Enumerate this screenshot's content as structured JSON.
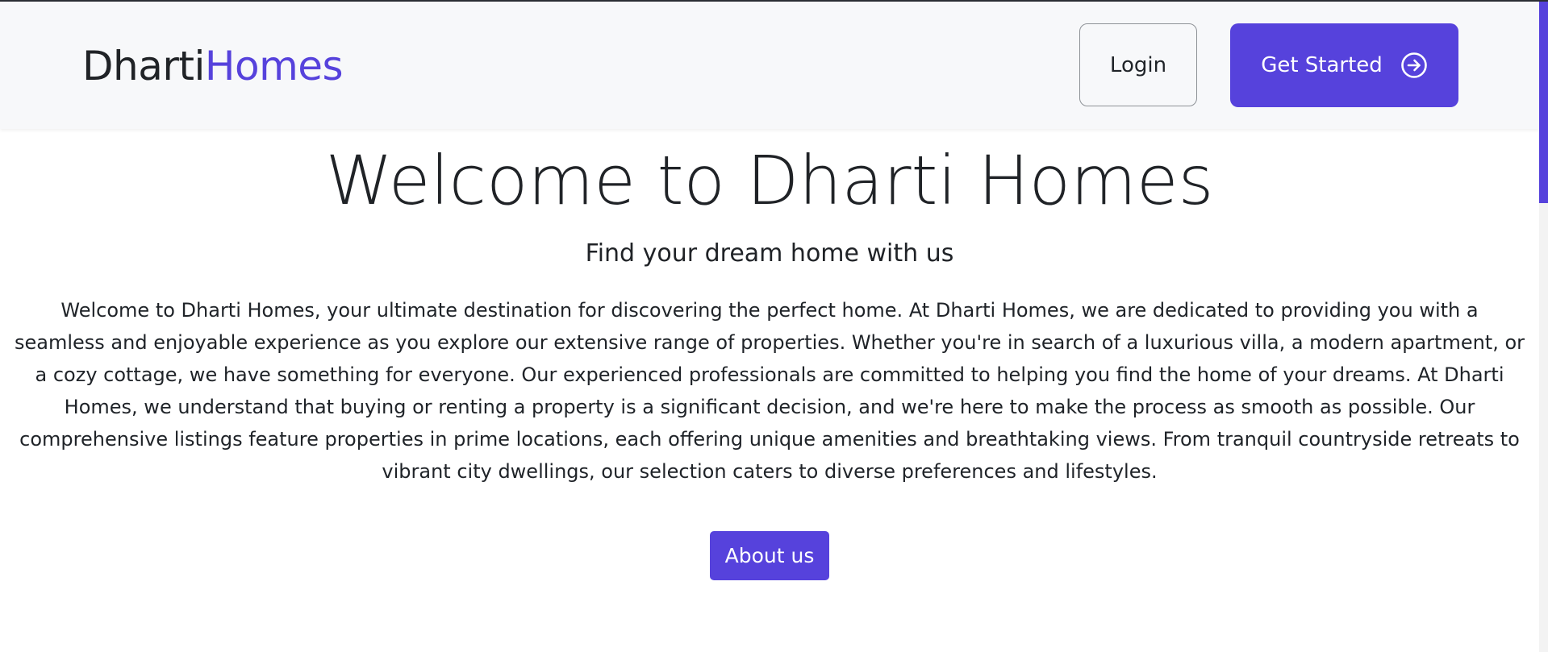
{
  "navbar": {
    "brand_part1": "Dharti",
    "brand_part2": "Homes",
    "login_label": "Login",
    "get_started_label": "Get Started"
  },
  "hero": {
    "title": "Welcome to Dharti Homes",
    "subtitle": "Find your dream home with us",
    "description": "Welcome to Dharti Homes, your ultimate destination for discovering the perfect home. At Dharti Homes, we are dedicated to providing you with a seamless and enjoyable experience as you explore our extensive range of properties. Whether you're in search of a luxurious villa, a modern apartment, or a cozy cottage, we have something for everyone. Our experienced professionals are committed to helping you find the home of your dreams. At Dharti Homes, we understand that buying or renting a property is a significant decision, and we're here to make the process as smooth as possible. Our comprehensive listings feature properties in prime locations, each offering unique amenities and breathtaking views. From tranquil countryside retreats to vibrant city dwellings, our selection caters to diverse preferences and lifestyles.",
    "about_label": "About us"
  },
  "icons": {
    "get_started": "arrow-right-circle-icon"
  },
  "colors": {
    "accent": "#5642dc",
    "text": "#202327",
    "navbar_bg": "#f7f8fa"
  }
}
